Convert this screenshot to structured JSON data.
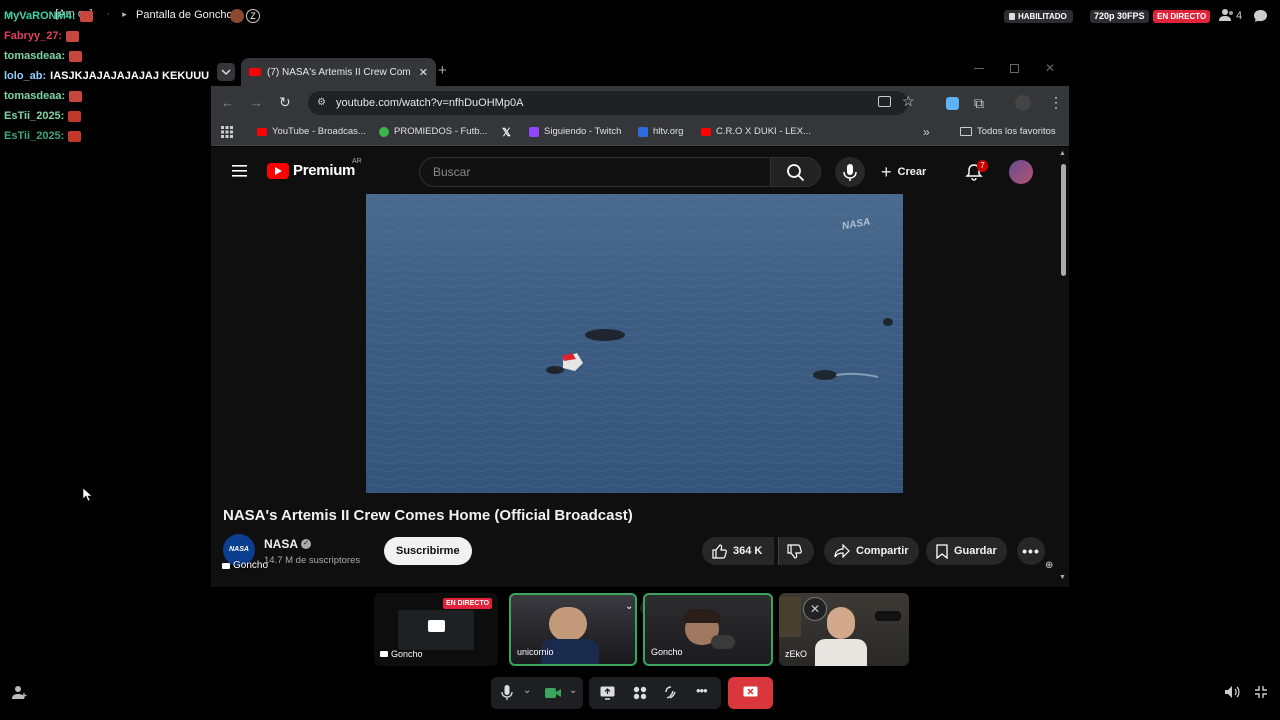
{
  "discord": {
    "breadcrumb_channel": "[Am os]",
    "screen_title": "Pantalla de Goncho",
    "badge_enabled": "HABILITADO",
    "quality": "720p 30FPS",
    "live_badge": "EN DIRECTO",
    "participant_count": "4",
    "colors": {
      "live": "#e0223a",
      "speaking": "#3ba55d"
    }
  },
  "chat": [
    {
      "user": "MyVaRONM4:",
      "message": "",
      "color": "#3fd3a6"
    },
    {
      "user": "Fabryy_27:",
      "message": "",
      "color": "#e0415c"
    },
    {
      "user": "tomasdeaa:",
      "message": "",
      "color": "#7fd6a4"
    },
    {
      "user": "lolo_ab:",
      "message": "IASJKJAJAJAJAJAJ KEKUUU",
      "color": "#8fd1ff"
    },
    {
      "user": "tomasdeaa:",
      "message": "",
      "color": "#7fd6a4"
    },
    {
      "user": "EsTii_2025:",
      "message": "",
      "color": "#7fd6a4"
    },
    {
      "user": "EsTii_2025:",
      "message": "",
      "color": "#3fa77f"
    }
  ],
  "browser": {
    "tab_title": "(7) NASA's Artemis II Crew Com",
    "url": "youtube.com/watch?v=nfhDuOHMp0A",
    "bookmarks": [
      {
        "label": "YouTube - Broadcas...",
        "color": "#ff0000"
      },
      {
        "label": "PROMIEDOS - Futb...",
        "color": "#3bb54a"
      },
      {
        "label": "",
        "color": "#ffffff"
      },
      {
        "label": "Siguiendo - Twitch",
        "color": "#9146ff"
      },
      {
        "label": "hltv.org",
        "color": "#2d6cdf"
      },
      {
        "label": "C.R.O X DUKI - LEX...",
        "color": "#ff0000"
      }
    ],
    "all_bookmarks": "Todos los favoritos"
  },
  "youtube": {
    "logo_text": "Premium",
    "region": "AR",
    "search_placeholder": "Buscar",
    "create_label": "Crear",
    "notif_count": "7",
    "video_title": "NASA's Artemis II Crew Comes Home (Official Broadcast)",
    "channel_name": "NASA",
    "subscribers": "14.7 M de suscriptores",
    "subscribe_label": "Suscribirme",
    "likes": "364 K",
    "share_label": "Compartir",
    "save_label": "Guardar",
    "watermark": "NASA"
  },
  "streamer_tag": "Goncho",
  "participants": [
    {
      "name": "Goncho",
      "live": "EN DIRECTO",
      "type": "screen"
    },
    {
      "name": "unicornio",
      "type": "cam"
    },
    {
      "name": "Goncho",
      "type": "cam"
    },
    {
      "name": "zEkO",
      "type": "cam"
    }
  ]
}
